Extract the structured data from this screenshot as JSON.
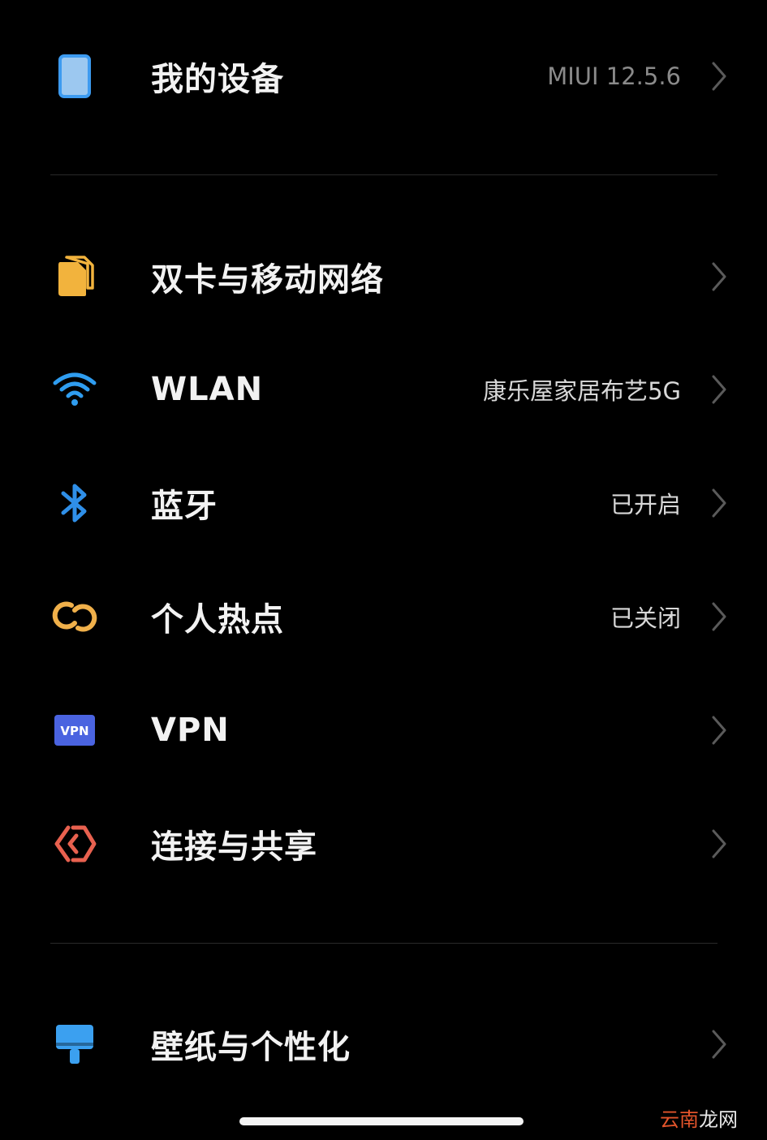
{
  "my_device": {
    "label": "我的设备",
    "value": "MIUI 12.5.6",
    "icon": "phone-icon"
  },
  "network_section": [
    {
      "key": "dual-sim",
      "label": "双卡与移动网络",
      "value": "",
      "icon": "sim-card-icon"
    },
    {
      "key": "wlan",
      "label": "WLAN",
      "value": "康乐屋家居布艺5G",
      "icon": "wifi-icon"
    },
    {
      "key": "bluetooth",
      "label": "蓝牙",
      "value": "已开启",
      "icon": "bluetooth-icon"
    },
    {
      "key": "hotspot",
      "label": "个人热点",
      "value": "已关闭",
      "icon": "hotspot-icon"
    },
    {
      "key": "vpn",
      "label": "VPN",
      "value": "",
      "icon": "vpn-icon",
      "icon_text": "VPN"
    },
    {
      "key": "connect-share",
      "label": "连接与共享",
      "value": "",
      "icon": "connect-share-icon"
    }
  ],
  "personal_section": [
    {
      "key": "wallpaper",
      "label": "壁纸与个性化",
      "value": "",
      "icon": "paint-brush-icon"
    }
  ],
  "watermark": {
    "part1": "云南",
    "part2": "龙网"
  },
  "colors": {
    "background": "#000000",
    "phone_icon": "#5aa9f0",
    "sim_icon": "#f2b33d",
    "wifi_icon": "#2f9df0",
    "bluetooth_icon": "#2f8fe8",
    "hotspot_icon": "#f0b04a",
    "vpn_icon": "#4a63e0",
    "connect_icon": "#e8614f",
    "wallpaper_icon": "#3ba0f0"
  }
}
